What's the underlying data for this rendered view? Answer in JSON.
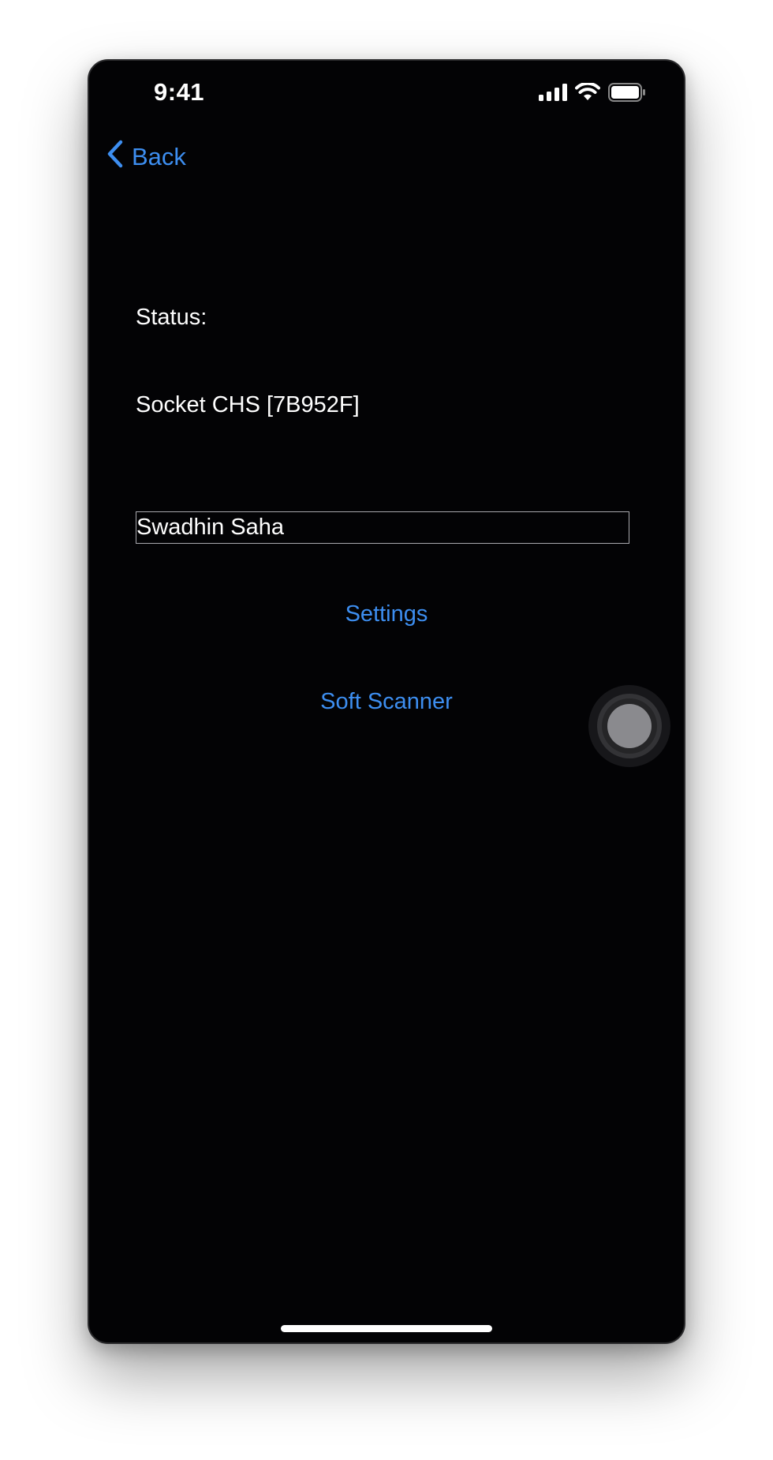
{
  "status_bar": {
    "time": "9:41",
    "icons": [
      "cellular-signal-icon",
      "wifi-icon",
      "battery-icon"
    ]
  },
  "nav": {
    "back_label": "Back",
    "back_icon": "chevron-left-icon"
  },
  "main": {
    "status_label": "Status:",
    "device_label": "Socket CHS [7B952F]",
    "name_field_value": "Swadhin Saha",
    "settings_label": "Settings",
    "soft_scanner_label": "Soft Scanner"
  },
  "colors": {
    "background": "#030305",
    "accent": "#3d8ef0",
    "text": "#ffffff"
  }
}
